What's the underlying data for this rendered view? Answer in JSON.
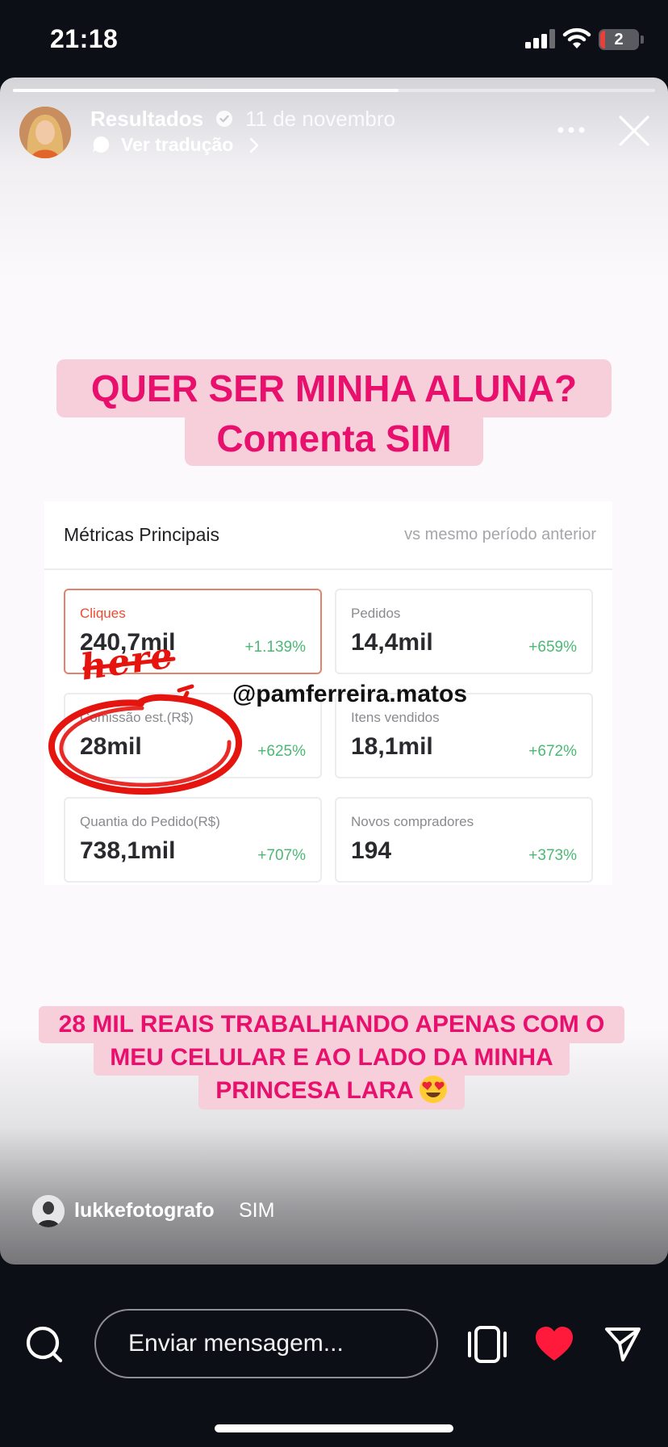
{
  "status_bar": {
    "time": "21:18",
    "battery": "2",
    "icons": [
      "signal-icon",
      "wifi-icon",
      "battery-icon"
    ]
  },
  "story": {
    "progress_fraction": 0.6,
    "username": "Resultados",
    "date": "11 de novembro",
    "translate_label": "Ver tradução",
    "headline": [
      "QUER SER MINHA ALUNA?",
      "Comenta SIM"
    ],
    "metrics": {
      "title": "Métricas Principais",
      "subtitle": "vs mesmo período anterior",
      "cards": [
        {
          "label": "Cliques",
          "value": "240,7mil",
          "change": "+1.139%"
        },
        {
          "label": "Pedidos",
          "value": "14,4mil",
          "change": "+659%"
        },
        {
          "label": "Comissão est.(R$)",
          "value": "28mil",
          "change": "+625%"
        },
        {
          "label": "Itens vendidos",
          "value": "18,1mil",
          "change": "+672%"
        },
        {
          "label": "Quantia do Pedido(R$)",
          "value": "738,1mil",
          "change": "+707%"
        },
        {
          "label": "Novos compradores",
          "value": "194",
          "change": "+373%"
        }
      ]
    },
    "annotation_text": "here",
    "mention": "@pamferreira.matos",
    "caption": [
      "28 MIL REAIS TRABALHANDO APENAS COM O",
      "MEU CELULAR E AO LADO DA MINHA",
      "PRINCESA LARA"
    ],
    "comment": {
      "user": "lukkefotografo",
      "text": "SIM"
    }
  },
  "bottom_bar": {
    "message_placeholder": "Enviar mensagem...",
    "icons": [
      "search-icon",
      "frame-icon",
      "heart-icon",
      "send-icon"
    ]
  },
  "colors": {
    "headline_text": "#e8106c",
    "headline_bg": "#f6cfdb",
    "positive_change": "#4cb874",
    "selected_accent": "#f04a2e",
    "heart": "#ff1a3c",
    "annotation": "#e5140f"
  }
}
